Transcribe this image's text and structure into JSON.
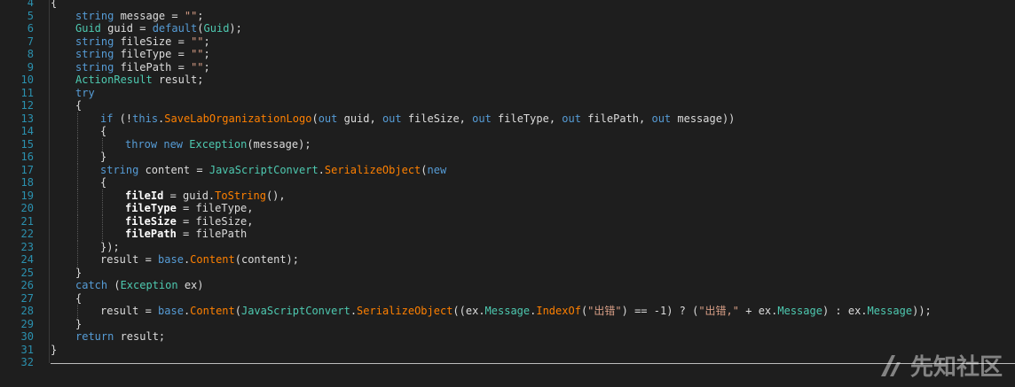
{
  "editor": {
    "lines": [
      {
        "n": "4",
        "indent": 0,
        "tokens": [
          {
            "c": "pl",
            "t": "{"
          }
        ]
      },
      {
        "n": "5",
        "indent": 1,
        "tokens": [
          {
            "c": "kw",
            "t": "string"
          },
          {
            "c": "pl",
            "t": " message = "
          },
          {
            "c": "st",
            "t": "\"\""
          },
          {
            "c": "pl",
            "t": ";"
          }
        ]
      },
      {
        "n": "6",
        "indent": 1,
        "tokens": [
          {
            "c": "ty",
            "t": "Guid"
          },
          {
            "c": "pl",
            "t": " guid = "
          },
          {
            "c": "kw",
            "t": "default"
          },
          {
            "c": "pl",
            "t": "("
          },
          {
            "c": "ty",
            "t": "Guid"
          },
          {
            "c": "pl",
            "t": ");"
          }
        ]
      },
      {
        "n": "7",
        "indent": 1,
        "tokens": [
          {
            "c": "kw",
            "t": "string"
          },
          {
            "c": "pl",
            "t": " fileSize = "
          },
          {
            "c": "st",
            "t": "\"\""
          },
          {
            "c": "pl",
            "t": ";"
          }
        ]
      },
      {
        "n": "8",
        "indent": 1,
        "tokens": [
          {
            "c": "kw",
            "t": "string"
          },
          {
            "c": "pl",
            "t": " fileType = "
          },
          {
            "c": "st",
            "t": "\"\""
          },
          {
            "c": "pl",
            "t": ";"
          }
        ]
      },
      {
        "n": "9",
        "indent": 1,
        "tokens": [
          {
            "c": "kw",
            "t": "string"
          },
          {
            "c": "pl",
            "t": " filePath = "
          },
          {
            "c": "st",
            "t": "\"\""
          },
          {
            "c": "pl",
            "t": ";"
          }
        ]
      },
      {
        "n": "10",
        "indent": 1,
        "tokens": [
          {
            "c": "ty",
            "t": "ActionResult"
          },
          {
            "c": "pl",
            "t": " result;"
          }
        ]
      },
      {
        "n": "11",
        "indent": 1,
        "tokens": [
          {
            "c": "kw",
            "t": "try"
          }
        ]
      },
      {
        "n": "12",
        "indent": 1,
        "tokens": [
          {
            "c": "pl",
            "t": "{"
          }
        ]
      },
      {
        "n": "13",
        "indent": 2,
        "tokens": [
          {
            "c": "kw",
            "t": "if"
          },
          {
            "c": "pl",
            "t": " (!"
          },
          {
            "c": "kw",
            "t": "this"
          },
          {
            "c": "pl",
            "t": "."
          },
          {
            "c": "mt",
            "t": "SaveLabOrganizationLogo"
          },
          {
            "c": "pl",
            "t": "("
          },
          {
            "c": "kw",
            "t": "out"
          },
          {
            "c": "pl",
            "t": " guid, "
          },
          {
            "c": "kw",
            "t": "out"
          },
          {
            "c": "pl",
            "t": " fileSize, "
          },
          {
            "c": "kw",
            "t": "out"
          },
          {
            "c": "pl",
            "t": " fileType, "
          },
          {
            "c": "kw",
            "t": "out"
          },
          {
            "c": "pl",
            "t": " filePath, "
          },
          {
            "c": "kw",
            "t": "out"
          },
          {
            "c": "pl",
            "t": " message))"
          }
        ]
      },
      {
        "n": "14",
        "indent": 2,
        "tokens": [
          {
            "c": "pl",
            "t": "{"
          }
        ]
      },
      {
        "n": "15",
        "indent": 3,
        "tokens": [
          {
            "c": "kw",
            "t": "throw"
          },
          {
            "c": "pl",
            "t": " "
          },
          {
            "c": "kw",
            "t": "new"
          },
          {
            "c": "pl",
            "t": " "
          },
          {
            "c": "ty",
            "t": "Exception"
          },
          {
            "c": "pl",
            "t": "(message);"
          }
        ]
      },
      {
        "n": "16",
        "indent": 2,
        "tokens": [
          {
            "c": "pl",
            "t": "}"
          }
        ]
      },
      {
        "n": "17",
        "indent": 2,
        "tokens": [
          {
            "c": "kw",
            "t": "string"
          },
          {
            "c": "pl",
            "t": " content = "
          },
          {
            "c": "ty",
            "t": "JavaScriptConvert"
          },
          {
            "c": "pl",
            "t": "."
          },
          {
            "c": "mt",
            "t": "SerializeObject"
          },
          {
            "c": "pl",
            "t": "("
          },
          {
            "c": "kw",
            "t": "new"
          }
        ]
      },
      {
        "n": "18",
        "indent": 2,
        "tokens": [
          {
            "c": "pl",
            "t": "{"
          }
        ]
      },
      {
        "n": "19",
        "indent": 3,
        "tokens": [
          {
            "c": "bd",
            "t": "fileId"
          },
          {
            "c": "pl",
            "t": " = guid."
          },
          {
            "c": "mt",
            "t": "ToString"
          },
          {
            "c": "pl",
            "t": "(),"
          }
        ]
      },
      {
        "n": "20",
        "indent": 3,
        "tokens": [
          {
            "c": "bd",
            "t": "fileType"
          },
          {
            "c": "pl",
            "t": " = fileType,"
          }
        ]
      },
      {
        "n": "21",
        "indent": 3,
        "tokens": [
          {
            "c": "bd",
            "t": "fileSize"
          },
          {
            "c": "pl",
            "t": " = fileSize,"
          }
        ]
      },
      {
        "n": "22",
        "indent": 3,
        "tokens": [
          {
            "c": "bd",
            "t": "filePath"
          },
          {
            "c": "pl",
            "t": " = filePath"
          }
        ]
      },
      {
        "n": "23",
        "indent": 2,
        "tokens": [
          {
            "c": "pl",
            "t": "});"
          }
        ]
      },
      {
        "n": "24",
        "indent": 2,
        "tokens": [
          {
            "c": "pl",
            "t": "result = "
          },
          {
            "c": "kw",
            "t": "base"
          },
          {
            "c": "pl",
            "t": "."
          },
          {
            "c": "mt",
            "t": "Content"
          },
          {
            "c": "pl",
            "t": "(content);"
          }
        ]
      },
      {
        "n": "25",
        "indent": 1,
        "tokens": [
          {
            "c": "pl",
            "t": "}"
          }
        ]
      },
      {
        "n": "26",
        "indent": 1,
        "tokens": [
          {
            "c": "kw",
            "t": "catch"
          },
          {
            "c": "pl",
            "t": " ("
          },
          {
            "c": "ty",
            "t": "Exception"
          },
          {
            "c": "pl",
            "t": " ex)"
          }
        ]
      },
      {
        "n": "27",
        "indent": 1,
        "tokens": [
          {
            "c": "pl",
            "t": "{"
          }
        ]
      },
      {
        "n": "28",
        "indent": 2,
        "tokens": [
          {
            "c": "pl",
            "t": "result = "
          },
          {
            "c": "kw",
            "t": "base"
          },
          {
            "c": "pl",
            "t": "."
          },
          {
            "c": "mt",
            "t": "Content"
          },
          {
            "c": "pl",
            "t": "("
          },
          {
            "c": "ty",
            "t": "JavaScriptConvert"
          },
          {
            "c": "pl",
            "t": "."
          },
          {
            "c": "mt",
            "t": "SerializeObject"
          },
          {
            "c": "pl",
            "t": "((ex."
          },
          {
            "c": "ty",
            "t": "Message"
          },
          {
            "c": "pl",
            "t": "."
          },
          {
            "c": "mt",
            "t": "IndexOf"
          },
          {
            "c": "pl",
            "t": "("
          },
          {
            "c": "st",
            "t": "\"出错\""
          },
          {
            "c": "pl",
            "t": ") == -1) ? ("
          },
          {
            "c": "st",
            "t": "\"出错,\""
          },
          {
            "c": "pl",
            "t": " + ex."
          },
          {
            "c": "ty",
            "t": "Message"
          },
          {
            "c": "pl",
            "t": ") : ex."
          },
          {
            "c": "ty",
            "t": "Message"
          },
          {
            "c": "pl",
            "t": "));"
          }
        ]
      },
      {
        "n": "29",
        "indent": 1,
        "tokens": [
          {
            "c": "pl",
            "t": "}"
          }
        ]
      },
      {
        "n": "30",
        "indent": 1,
        "tokens": [
          {
            "c": "kw",
            "t": "return"
          },
          {
            "c": "pl",
            "t": " result;"
          }
        ]
      },
      {
        "n": "31",
        "indent": 0,
        "tokens": [
          {
            "c": "pl",
            "t": "}"
          }
        ]
      },
      {
        "n": "32",
        "indent": 0,
        "tokens": []
      }
    ]
  },
  "watermark": {
    "text": "先知社区",
    "icon": "xianzhi-logo-icon"
  },
  "colors": {
    "background": "#1e1e1e",
    "line_number": "#2b91af",
    "keyword": "#569cd6",
    "type": "#4ec9b0",
    "method": "#ff8000",
    "string": "#d69d85",
    "plain": "#dcdcdc"
  }
}
